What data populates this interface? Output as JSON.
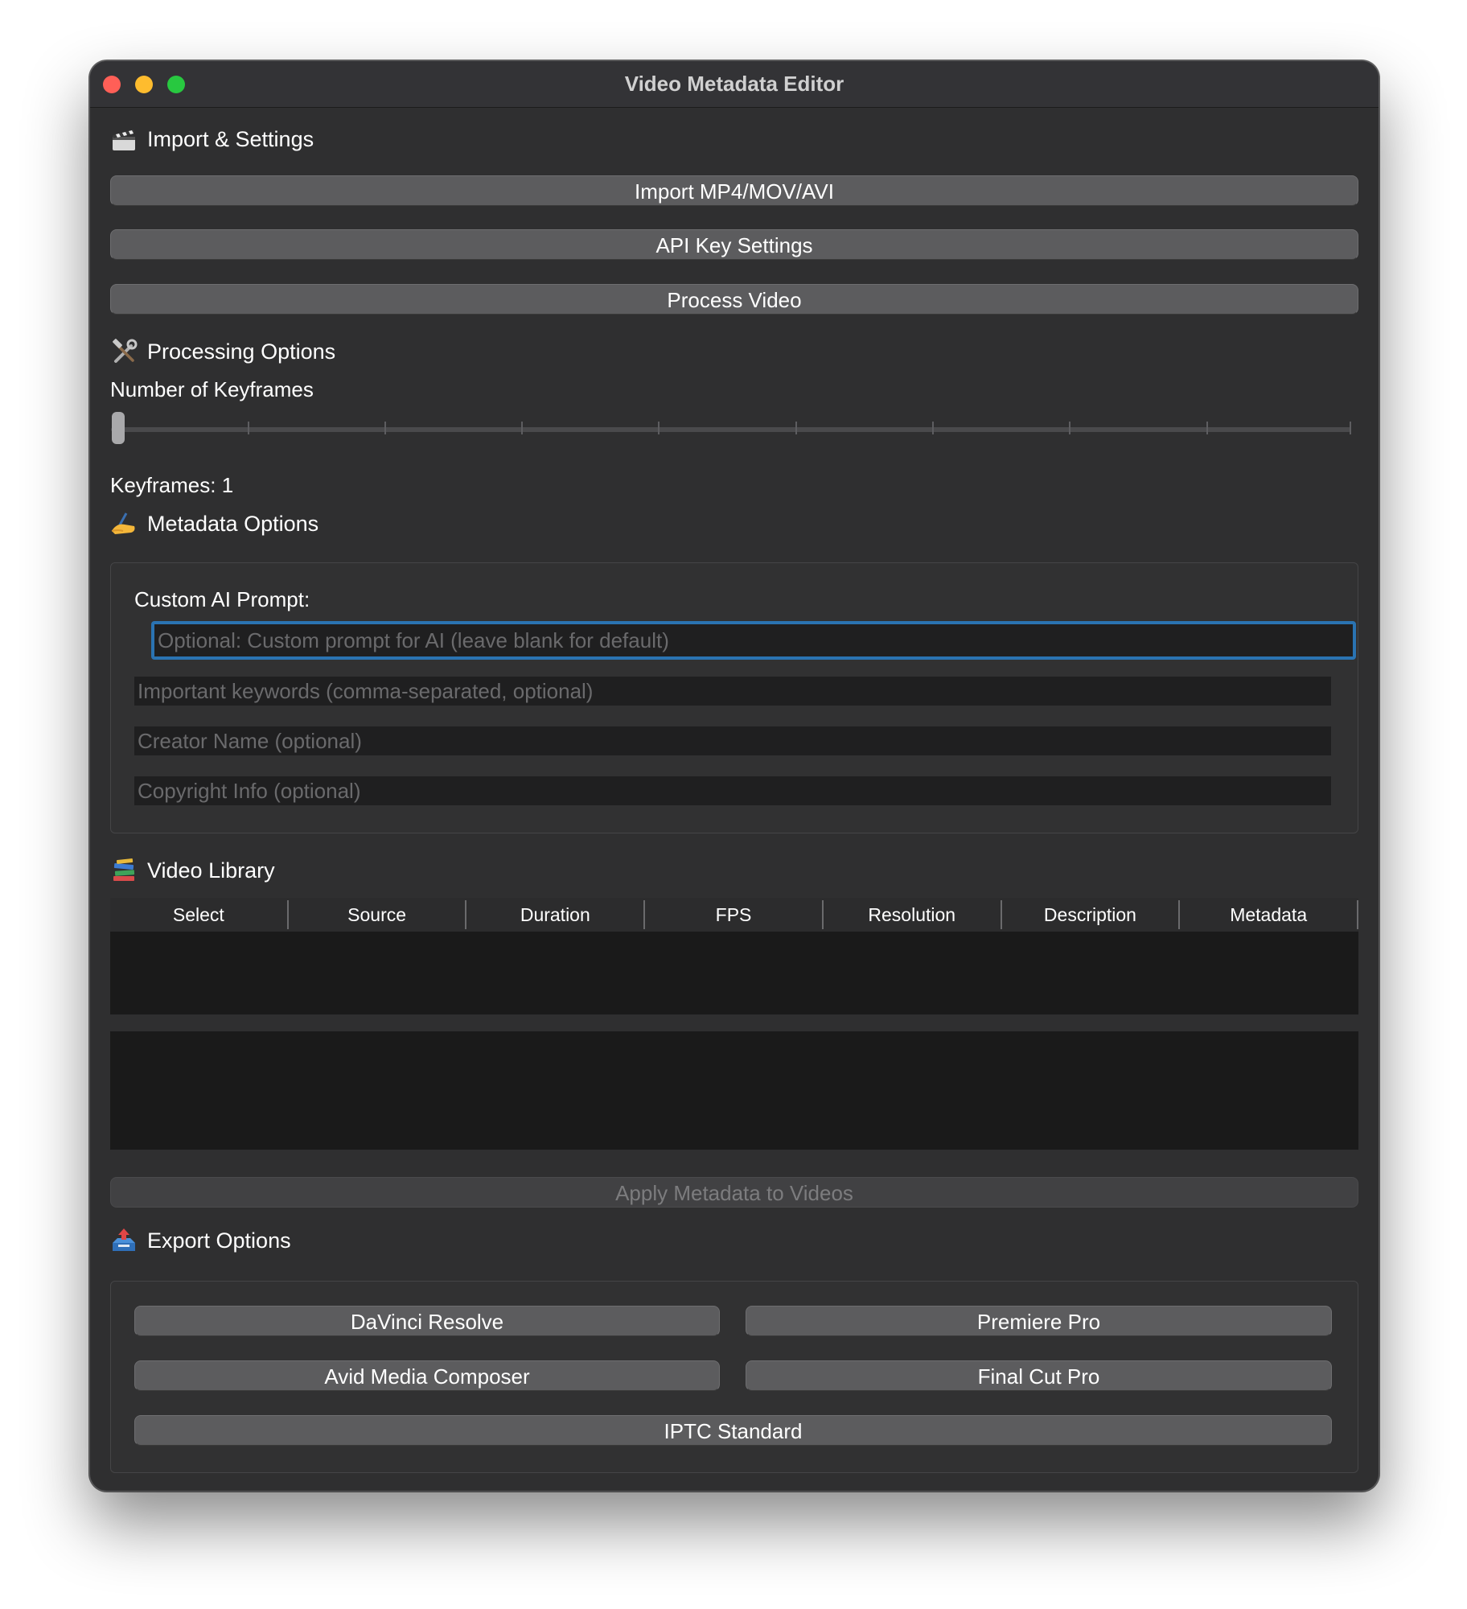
{
  "window": {
    "title": "Video Metadata Editor"
  },
  "import_settings": {
    "header": "Import & Settings",
    "icon": "clapperboard-icon",
    "import_button": "Import MP4/MOV/AVI",
    "api_key_button": "API Key Settings",
    "process_button": "Process Video"
  },
  "processing": {
    "header": "Processing Options",
    "icon": "hammer-wrench-icon",
    "keyframes_label": "Number of Keyframes",
    "keyframes_value_text": "Keyframes: 1",
    "slider_value": 1
  },
  "metadata": {
    "header": "Metadata Options",
    "icon": "writing-hand-icon",
    "prompt_label": "Custom AI Prompt:",
    "prompt_placeholder": "Optional: Custom prompt for AI (leave blank for default)",
    "keywords_placeholder": "Important keywords (comma-separated, optional)",
    "creator_placeholder": "Creator Name (optional)",
    "copyright_placeholder": "Copyright Info (optional)"
  },
  "library": {
    "header": "Video Library",
    "icon": "books-icon",
    "columns": [
      "Select",
      "Source",
      "Duration",
      "FPS",
      "Resolution",
      "Description",
      "Metadata"
    ],
    "rows": [],
    "apply_button": "Apply Metadata to Videos"
  },
  "export": {
    "header": "Export Options",
    "icon": "outbox-tray-icon",
    "davinci": "DaVinci Resolve",
    "premiere": "Premiere Pro",
    "avid": "Avid Media Composer",
    "finalcut": "Final Cut Pro",
    "iptc": "IPTC Standard"
  },
  "colors": {
    "window_bg": "#2f2f30",
    "button_bg": "#5c5c5e",
    "focus_ring": "#2a73b2",
    "close": "#ff5f57",
    "minimize": "#febc2e",
    "zoom": "#28c840"
  }
}
